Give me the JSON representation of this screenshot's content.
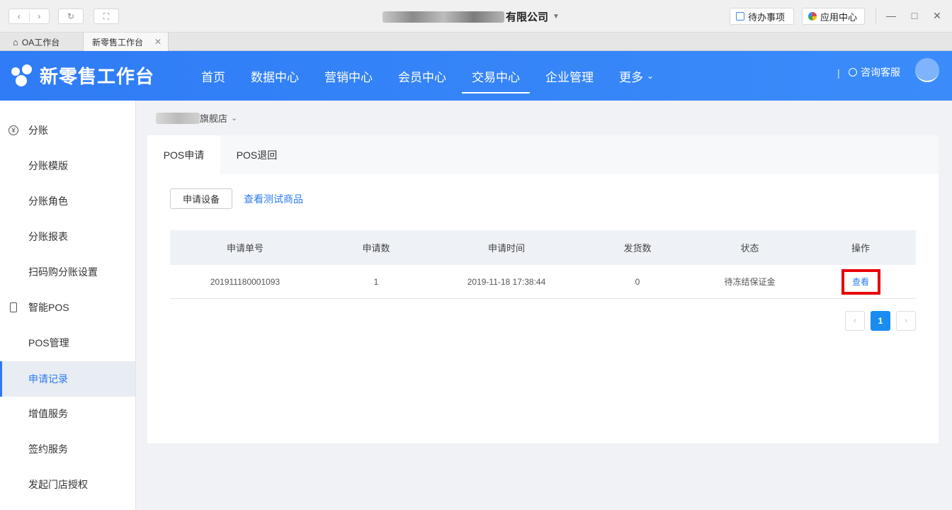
{
  "window": {
    "company_suffix": "有限公司",
    "todo_label": "待办事项",
    "app_center_label": "应用中心"
  },
  "browser_tabs": [
    {
      "label": "OA工作台"
    },
    {
      "label": "新零售工作台"
    }
  ],
  "header": {
    "title": "新零售工作台",
    "nav": [
      "首页",
      "数据中心",
      "营销中心",
      "会员中心",
      "交易中心",
      "企业管理",
      "更多"
    ],
    "active_nav": "交易中心",
    "separator": "|",
    "consult_label": "咨询客服"
  },
  "sidebar": {
    "items": [
      {
        "label": "分账",
        "type": "group",
        "icon": "yen-icon"
      },
      {
        "label": "分账模版",
        "type": "sub"
      },
      {
        "label": "分账角色",
        "type": "sub"
      },
      {
        "label": "分账报表",
        "type": "sub"
      },
      {
        "label": "扫码购分账设置",
        "type": "sub"
      },
      {
        "label": "智能POS",
        "type": "group",
        "icon": "pos-icon"
      },
      {
        "label": "POS管理",
        "type": "sub"
      },
      {
        "label": "申请记录",
        "type": "sub",
        "active": true
      },
      {
        "label": "增值服务",
        "type": "sub"
      },
      {
        "label": "签约服务",
        "type": "sub"
      },
      {
        "label": "发起门店授权",
        "type": "sub"
      }
    ]
  },
  "store": {
    "name_suffix": "旗舰店"
  },
  "tabs": [
    {
      "label": "POS申请",
      "active": true
    },
    {
      "label": "POS退回"
    }
  ],
  "actions": {
    "apply_label": "申请设备",
    "test_link": "查看测试商品"
  },
  "table": {
    "headers": [
      "申请单号",
      "申请数",
      "申请时间",
      "发货数",
      "状态",
      "操作"
    ],
    "rows": [
      {
        "order_no": "201911180001093",
        "count": "1",
        "time": "2019-11-18 17:38:44",
        "shipped": "0",
        "status": "待冻结保证金",
        "action": "查看"
      }
    ]
  },
  "pagination": {
    "prev": "‹",
    "current": "1",
    "next": "›"
  },
  "colors": {
    "primary": "#2f7cf6",
    "highlight": "#e8000a",
    "page_active": "#1a8cf0"
  }
}
